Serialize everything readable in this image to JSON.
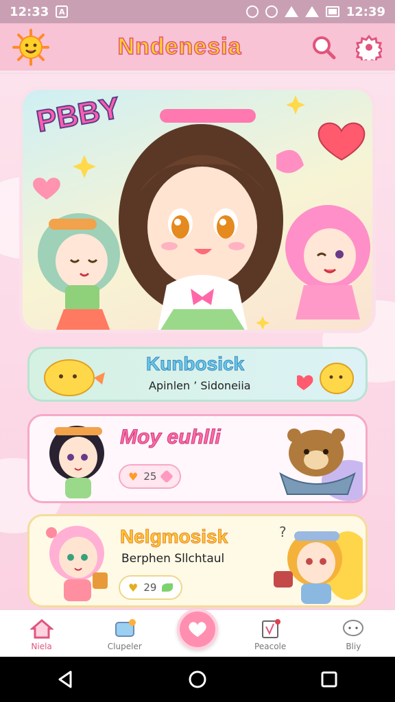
{
  "status_bar": {
    "time_left": "12:33",
    "time_right": "12:39",
    "left_icon": "A"
  },
  "app_bar": {
    "title": "Nndenesia",
    "logo_icon": "sun-face-icon",
    "search_icon": "search-icon",
    "settings_icon": "gear-icon"
  },
  "hero": {
    "badge_text": "PBBY"
  },
  "cards": [
    {
      "title": "Kunbosick",
      "subtitle": "Apinlen ’ Sidoneiia"
    },
    {
      "title": "Moy euhlli",
      "count": "25"
    },
    {
      "title": "Nelgmosisk",
      "subtitle": "Berphen Sllchtaul",
      "count": "29"
    }
  ],
  "bottom_nav": {
    "items": [
      {
        "label": "Niela",
        "icon": "home-icon",
        "active": true
      },
      {
        "label": "Clupeler",
        "icon": "puzzle-icon"
      },
      {
        "label": "Peacole",
        "icon": "notes-icon"
      },
      {
        "label": "Bliy",
        "icon": "chat-icon"
      }
    ],
    "center_icon": "heart-bubble-icon"
  },
  "colors": {
    "accent_pink": "#ff8fb1",
    "title_yellow": "#ffd02a",
    "app_bar": "#f8c3d4"
  }
}
